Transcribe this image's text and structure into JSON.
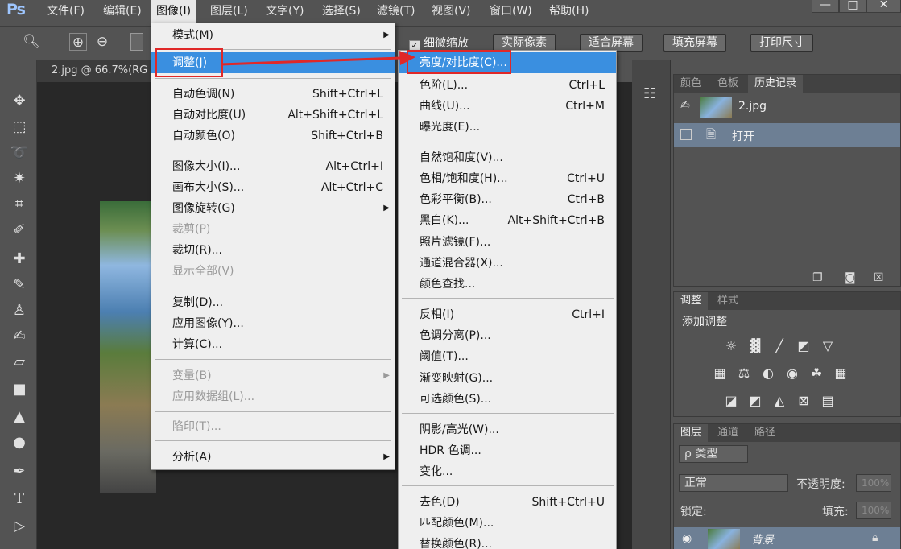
{
  "app": {
    "logo": "Ps"
  },
  "menubar": {
    "items": [
      "文件(F)",
      "编辑(E)",
      "图像(I)",
      "图层(L)",
      "文字(Y)",
      "选择(S)",
      "滤镜(T)",
      "视图(V)",
      "窗口(W)",
      "帮助(H)"
    ],
    "active": "图像(I)"
  },
  "window_controls": {
    "minimize": "—",
    "restore": "□",
    "close": "✕"
  },
  "options": {
    "check_label": "细微缩放",
    "buttons": [
      "实际像素",
      "适合屏幕",
      "填充屏幕",
      "打印尺寸"
    ]
  },
  "document": {
    "tab_title": "2.jpg @ 66.7%(RG"
  },
  "image_menu": {
    "items": [
      {
        "label": "模式(M)",
        "shortcut": "",
        "submenu": true
      },
      {
        "label": "调整(J)",
        "shortcut": "",
        "submenu": false,
        "highlighted": true
      },
      {
        "label": "自动色调(N)",
        "shortcut": "Shift+Ctrl+L"
      },
      {
        "label": "自动对比度(U)",
        "shortcut": "Alt+Shift+Ctrl+L"
      },
      {
        "label": "自动颜色(O)",
        "shortcut": "Shift+Ctrl+B"
      },
      {
        "label": "图像大小(I)...",
        "shortcut": "Alt+Ctrl+I"
      },
      {
        "label": "画布大小(S)...",
        "shortcut": "Alt+Ctrl+C"
      },
      {
        "label": "图像旋转(G)",
        "shortcut": "",
        "submenu": true
      },
      {
        "label": "裁剪(P)",
        "shortcut": "",
        "disabled": true
      },
      {
        "label": "裁切(R)...",
        "shortcut": ""
      },
      {
        "label": "显示全部(V)",
        "shortcut": "",
        "disabled": true
      },
      {
        "label": "复制(D)...",
        "shortcut": ""
      },
      {
        "label": "应用图像(Y)...",
        "shortcut": ""
      },
      {
        "label": "计算(C)...",
        "shortcut": ""
      },
      {
        "label": "变量(B)",
        "shortcut": "",
        "submenu": true,
        "disabled": true
      },
      {
        "label": "应用数据组(L)...",
        "shortcut": "",
        "disabled": true
      },
      {
        "label": "陷印(T)...",
        "shortcut": "",
        "disabled": true
      },
      {
        "label": "分析(A)",
        "shortcut": "",
        "submenu": true
      }
    ]
  },
  "adjust_menu": {
    "items": [
      {
        "label": "亮度/对比度(C)...",
        "shortcut": "",
        "highlighted": true
      },
      {
        "label": "色阶(L)...",
        "shortcut": "Ctrl+L"
      },
      {
        "label": "曲线(U)...",
        "shortcut": "Ctrl+M"
      },
      {
        "label": "曝光度(E)...",
        "shortcut": ""
      },
      {
        "label": "自然饱和度(V)...",
        "shortcut": ""
      },
      {
        "label": "色相/饱和度(H)...",
        "shortcut": "Ctrl+U"
      },
      {
        "label": "色彩平衡(B)...",
        "shortcut": "Ctrl+B"
      },
      {
        "label": "黑白(K)...",
        "shortcut": "Alt+Shift+Ctrl+B"
      },
      {
        "label": "照片滤镜(F)...",
        "shortcut": ""
      },
      {
        "label": "通道混合器(X)...",
        "shortcut": ""
      },
      {
        "label": "颜色查找...",
        "shortcut": ""
      },
      {
        "label": "反相(I)",
        "shortcut": "Ctrl+I"
      },
      {
        "label": "色调分离(P)...",
        "shortcut": ""
      },
      {
        "label": "阈值(T)...",
        "shortcut": ""
      },
      {
        "label": "渐变映射(G)...",
        "shortcut": ""
      },
      {
        "label": "可选颜色(S)...",
        "shortcut": ""
      },
      {
        "label": "阴影/高光(W)...",
        "shortcut": ""
      },
      {
        "label": "HDR 色调...",
        "shortcut": ""
      },
      {
        "label": "变化...",
        "shortcut": ""
      },
      {
        "label": "去色(D)",
        "shortcut": "Shift+Ctrl+U"
      },
      {
        "label": "匹配颜色(M)...",
        "shortcut": ""
      },
      {
        "label": "替换颜色(R)...",
        "shortcut": ""
      }
    ]
  },
  "history_panel": {
    "tabs": [
      "颜色",
      "色板",
      "历史记录"
    ],
    "active_tab": "历史记录",
    "snapshot": "2.jpg",
    "step": "打开"
  },
  "adjustments_panel": {
    "tabs": [
      "调整",
      "样式"
    ],
    "active_tab": "调整",
    "title": "添加调整"
  },
  "layers_panel": {
    "tabs": [
      "图层",
      "通道",
      "路径"
    ],
    "active_tab": "图层",
    "filter_label": "ρ 类型",
    "blend_mode": "正常",
    "opacity_label": "不透明度:",
    "opacity_value": "100%",
    "lock_label": "锁定:",
    "fill_label": "填充:",
    "fill_value": "100%",
    "layer_name": "背景"
  },
  "colors": {
    "accent": "#3a8fe0",
    "annotation": "#e02828"
  }
}
